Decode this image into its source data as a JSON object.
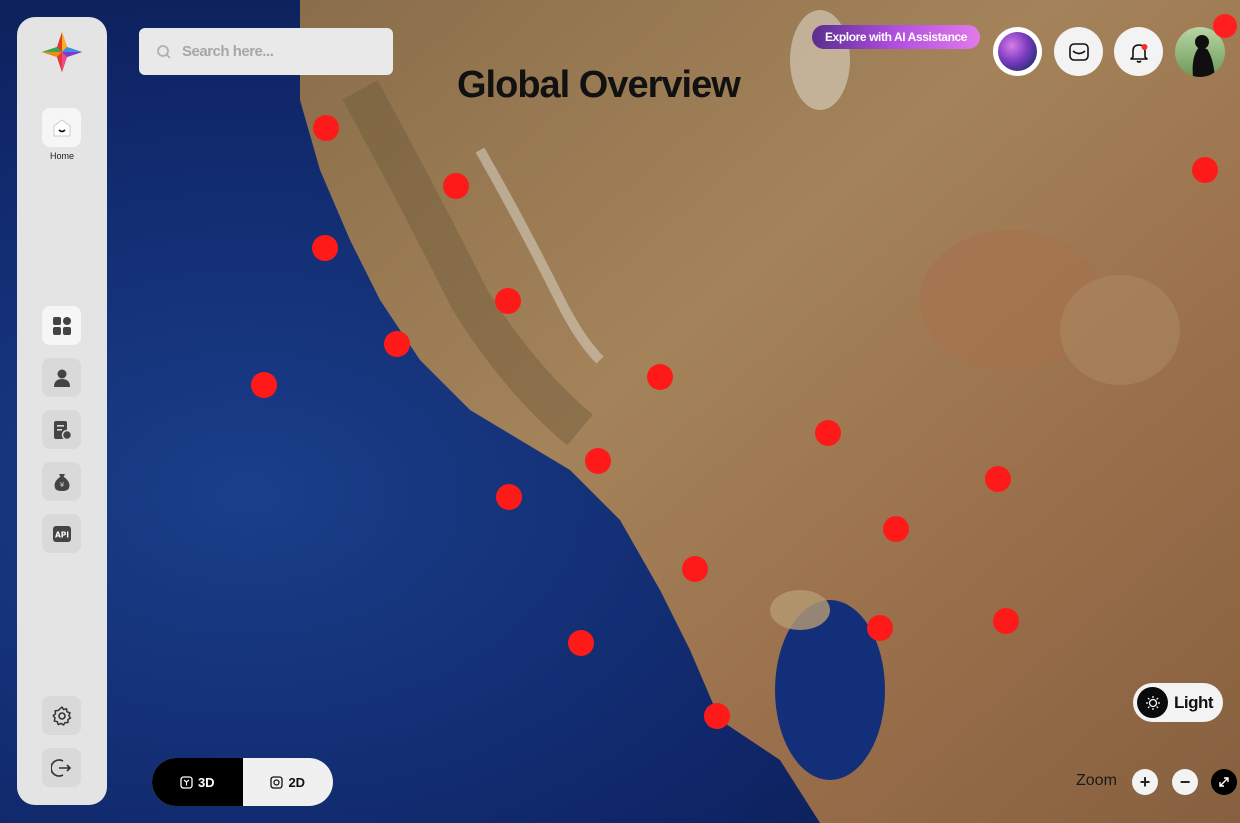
{
  "search": {
    "placeholder": "Search here..."
  },
  "page_title": "Global Overview",
  "ai_button_label": "Explore with AI Assistance",
  "sidebar": {
    "home_label": "Home",
    "api_label": "API",
    "icons": [
      "home-icon",
      "dashboard-icon",
      "user-icon",
      "report-icon",
      "money-bag-icon",
      "api-icon",
      "settings-icon",
      "logout-icon"
    ]
  },
  "theme_toggle": {
    "label": "Light"
  },
  "view_toggle": {
    "option_3d": "3D",
    "option_2d": "2D",
    "selected": "3D"
  },
  "zoom": {
    "label": "Zoom",
    "in": "+",
    "out": "−"
  },
  "colors": {
    "marker": "#ff1a1a",
    "sidebar": "#e4e4e4",
    "ai_gradient_start": "#5b2d8f",
    "ai_gradient_end": "#e27ae8",
    "ocean": "#0d2a6b",
    "land": "#9c7a52"
  },
  "map": {
    "markers": [
      {
        "id": 1
      },
      {
        "id": 2
      },
      {
        "id": 3
      },
      {
        "id": 4
      },
      {
        "id": 5
      },
      {
        "id": 6
      },
      {
        "id": 7
      },
      {
        "id": 8
      },
      {
        "id": 9
      },
      {
        "id": 10
      },
      {
        "id": 11
      },
      {
        "id": 12
      },
      {
        "id": 13
      },
      {
        "id": 14
      },
      {
        "id": 15
      },
      {
        "id": 16
      },
      {
        "id": 17
      },
      {
        "id": 18
      }
    ]
  }
}
